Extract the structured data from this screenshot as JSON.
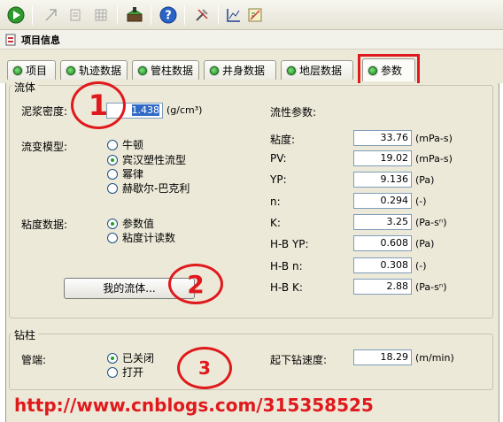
{
  "caption": {
    "title": "项目信息"
  },
  "tabs": [
    {
      "label": "项目"
    },
    {
      "label": "轨迹数据"
    },
    {
      "label": "管柱数据"
    },
    {
      "label": "井身数据"
    },
    {
      "label": "地层数据"
    },
    {
      "label": "参数"
    }
  ],
  "fluid": {
    "group_label": "流体",
    "density_label": "泥浆密度:",
    "density_value": "1.438",
    "density_unit": "(g/cm³)",
    "rheo_model_label": "流变模型:",
    "rheo_models": [
      "牛顿",
      "宾汉塑性流型",
      "幂律",
      "赫歇尔-巴克利"
    ],
    "viscosity_data_label": "粘度数据:",
    "viscosity_sources": [
      "参数值",
      "粘度计读数"
    ],
    "my_fluid_button": "我的流体...",
    "rheo_params_label": "流性参数:",
    "params": [
      {
        "label": "粘度:",
        "value": "33.76",
        "unit": "(mPa-s)"
      },
      {
        "label": "PV:",
        "value": "19.02",
        "unit": "(mPa-s)"
      },
      {
        "label": "YP:",
        "value": "9.136",
        "unit": "(Pa)"
      },
      {
        "label": "n:",
        "value": "0.294",
        "unit": "(-)"
      },
      {
        "label": "K:",
        "value": "3.25",
        "unit": "(Pa-sⁿ)"
      },
      {
        "label": "H-B YP:",
        "value": "0.608",
        "unit": "(Pa)"
      },
      {
        "label": "H-B n:",
        "value": "0.308",
        "unit": "(-)"
      },
      {
        "label": "H-B K:",
        "value": "2.88",
        "unit": "(Pa-sⁿ)"
      }
    ]
  },
  "drillstring": {
    "group_label": "钻柱",
    "pipe_end_label": "管端:",
    "pipe_end_options": [
      "已关闭",
      "打开"
    ],
    "trip_speed_label": "起下钻速度:",
    "trip_speed_value": "18.29",
    "trip_speed_unit": "(m/min)"
  },
  "annotations": {
    "one": "1",
    "two": "2",
    "three": "3"
  },
  "watermark": "http://www.cnblogs.com/315358525",
  "colors": {
    "annotation_red": "#e0191d",
    "panel_bg": "#ece9d8"
  }
}
